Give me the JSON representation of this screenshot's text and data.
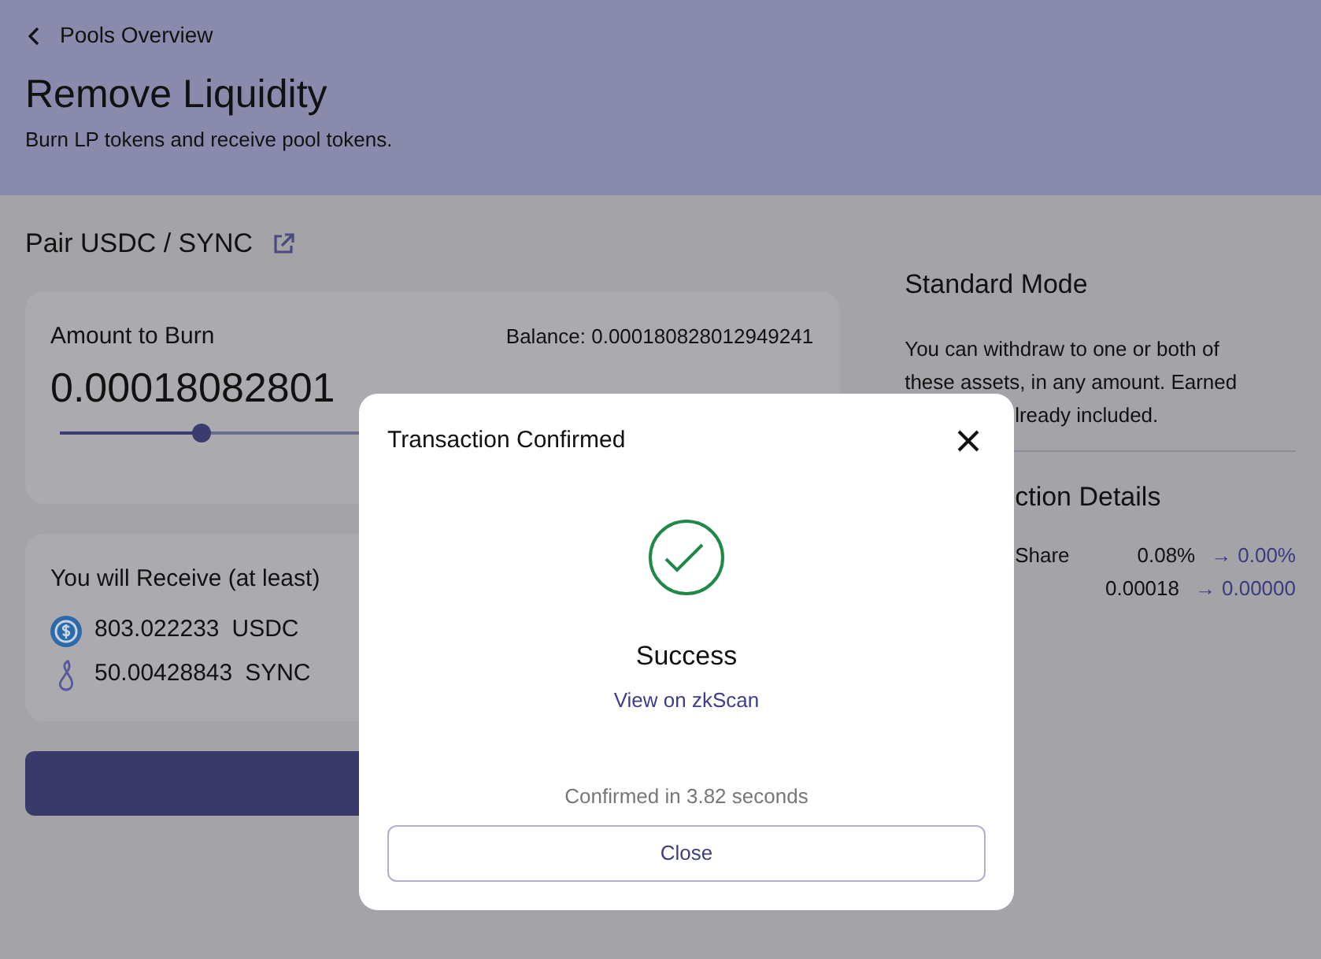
{
  "header": {
    "back_link": "Pools Overview",
    "title": "Remove Liquidity",
    "subtitle": "Burn LP tokens and receive pool tokens."
  },
  "pair": {
    "title": "Pair USDC / SYNC"
  },
  "burn": {
    "label": "Amount to Burn",
    "balance": "Balance: 0.000180828012949241",
    "amount": "0.00018082801",
    "level": 0.19
  },
  "receive": {
    "title": "You will Receive (at least)",
    "tokens": [
      {
        "kind": "usdc",
        "amount": "803.022233",
        "symbol": "USDC"
      },
      {
        "kind": "sync",
        "amount": "50.00428843",
        "symbol": "SYNC"
      }
    ]
  },
  "info": {
    "title": "Standard Mode",
    "text": "You can withdraw to one or both of these assets, in any amount. Earned",
    "text_tail": "lready included."
  },
  "details": {
    "title": "ction Details",
    "rows": [
      {
        "label": "Share",
        "from": "0.08%",
        "arrow": "→",
        "to": "0.00%"
      },
      {
        "from": "0.00018",
        "arrow": "→",
        "to": "0.00000"
      }
    ]
  },
  "modal": {
    "title": "Transaction Confirmed",
    "status": "Success",
    "link": "View on zkScan",
    "note": "Confirmed in 3.82 seconds",
    "close_button": "Close"
  }
}
